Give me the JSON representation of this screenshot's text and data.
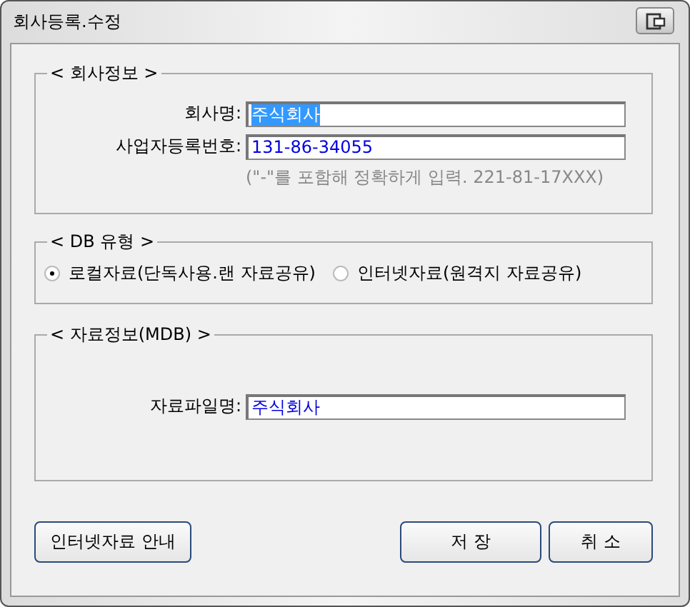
{
  "window": {
    "title": "회사등록.수정"
  },
  "company_info": {
    "title": "< 회사정보 >",
    "fields": [
      {
        "label": "회사명:",
        "value": "주식회사",
        "highlighted": true
      },
      {
        "label": "사업자등록번호:",
        "value": "131-86-34055",
        "highlighted": false
      }
    ],
    "hint": "(\"-\"를 포함해 정확하게 입력. 221-81-17XXX)"
  },
  "db_type": {
    "title": "< DB 유형 >",
    "options": [
      {
        "label": "로컬자료(단독사용.랜 자료공유)",
        "selected": true
      },
      {
        "label": "인터넷자료(원격지 자료공유)",
        "selected": false
      }
    ]
  },
  "data_info": {
    "title": "< 자료정보(MDB) >",
    "fields": [
      {
        "label": "자료파일명:",
        "value": "주식회사",
        "highlighted": false
      }
    ]
  },
  "buttons": {
    "left": [
      "인터넷자료 안내"
    ],
    "right": [
      "저 장",
      "취 소"
    ]
  }
}
